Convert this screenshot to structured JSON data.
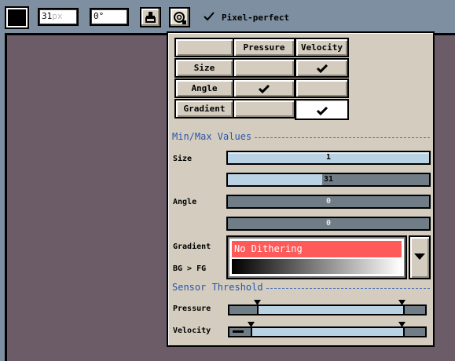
{
  "toolbar": {
    "color_swatch": "#000000",
    "brush_size": {
      "value": "31",
      "unit": "px"
    },
    "angle": {
      "value": "0",
      "unit": "°"
    },
    "icons": [
      "ink-bottle-icon",
      "dynamics-icon"
    ],
    "pixel_perfect": {
      "checked": true,
      "label": "Pixel-perfect"
    }
  },
  "popup": {
    "table": {
      "columns": [
        "",
        "Pressure",
        "Velocity"
      ],
      "rows": [
        {
          "label": "Size",
          "pressure": false,
          "velocity": true
        },
        {
          "label": "Angle",
          "pressure": true,
          "velocity": false
        },
        {
          "label": "Gradient",
          "pressure": false,
          "velocity": true
        }
      ]
    },
    "minmax_title": "Min/Max Values",
    "size_label": "Size",
    "size_min": {
      "value": "1",
      "fraction": 1.0
    },
    "size_max": {
      "value": "31",
      "fraction": 0.47
    },
    "angle_label": "Angle",
    "angle_min": {
      "value": "0",
      "fraction": 0.0
    },
    "angle_max": {
      "value": "0",
      "fraction": 0.0
    },
    "gradient_label": "Gradient",
    "gradient_sub": "BG > FG",
    "gradient_selected": "No Dithering",
    "sensor_title": "Sensor Threshold",
    "pressure_label": "Pressure",
    "velocity_label": "Velocity",
    "pressure_threshold": {
      "min": 0.14,
      "max": 0.88
    },
    "velocity_threshold": {
      "min": 0.11,
      "max": 0.88
    }
  },
  "colors": {
    "toolbar_bg": "#7d8fa0",
    "canvas_bg": "#6b5c68",
    "panel_bg": "#d4cdbf",
    "selection_red": "#ff5a5a",
    "slider_fill": "#b9d2e4",
    "section_blue": "#2a55a8"
  }
}
